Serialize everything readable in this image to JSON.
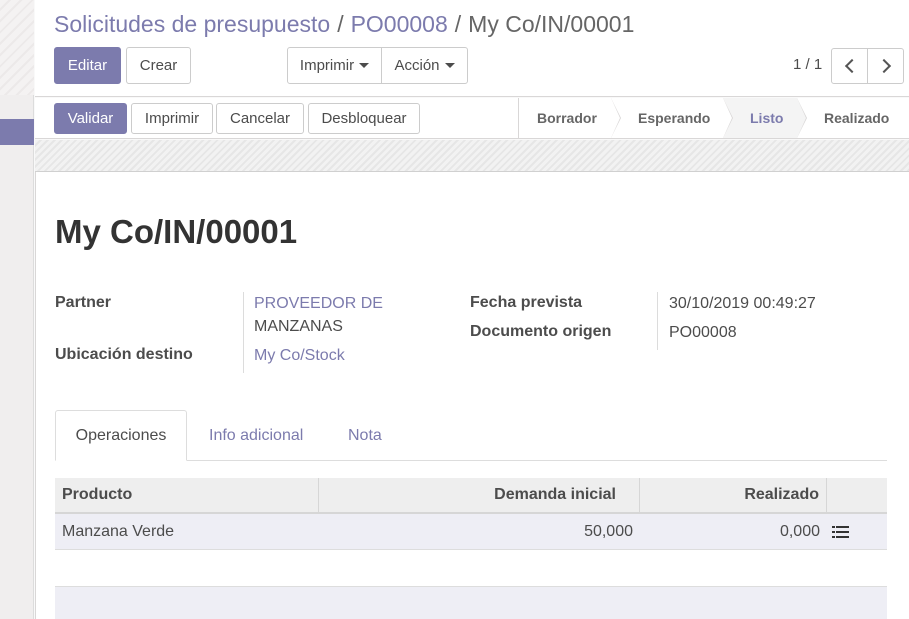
{
  "breadcrumb": {
    "items": [
      "Solicitudes de presupuesto",
      "PO00008"
    ],
    "current": "My Co/IN/00001",
    "separator": "/"
  },
  "toolbar": {
    "edit_label": "Editar",
    "create_label": "Crear",
    "print_label": "Imprimir",
    "action_label": "Acción"
  },
  "pager": {
    "value": "1 / 1"
  },
  "statusbar": {
    "validate_label": "Validar",
    "print_label": "Imprimir",
    "cancel_label": "Cancelar",
    "unlock_label": "Desbloquear",
    "stages": [
      "Borrador",
      "Esperando",
      "Listo",
      "Realizado"
    ],
    "current_stage": "Listo"
  },
  "record": {
    "title": "My Co/IN/00001",
    "partner_label": "Partner",
    "partner_line1": "PROVEEDOR DE",
    "partner_line2": "MANZANAS",
    "destination_label": "Ubicación destino",
    "destination_value": "My Co/Stock",
    "scheduled_label": "Fecha prevista",
    "scheduled_value": "30/10/2019 00:49:27",
    "origin_label": "Documento origen",
    "origin_value": "PO00008"
  },
  "tabs": [
    {
      "label": "Operaciones",
      "active": true
    },
    {
      "label": "Info adicional",
      "active": false
    },
    {
      "label": "Nota",
      "active": false
    }
  ],
  "operations": {
    "headers": [
      "Producto",
      "Demanda inicial",
      "Realizado"
    ],
    "rows": [
      {
        "product": "Manzana Verde",
        "demand": "50,000",
        "done": "0,000"
      }
    ]
  },
  "colors": {
    "accent": "#7c7bad",
    "row_highlight": "#eeeef5"
  }
}
